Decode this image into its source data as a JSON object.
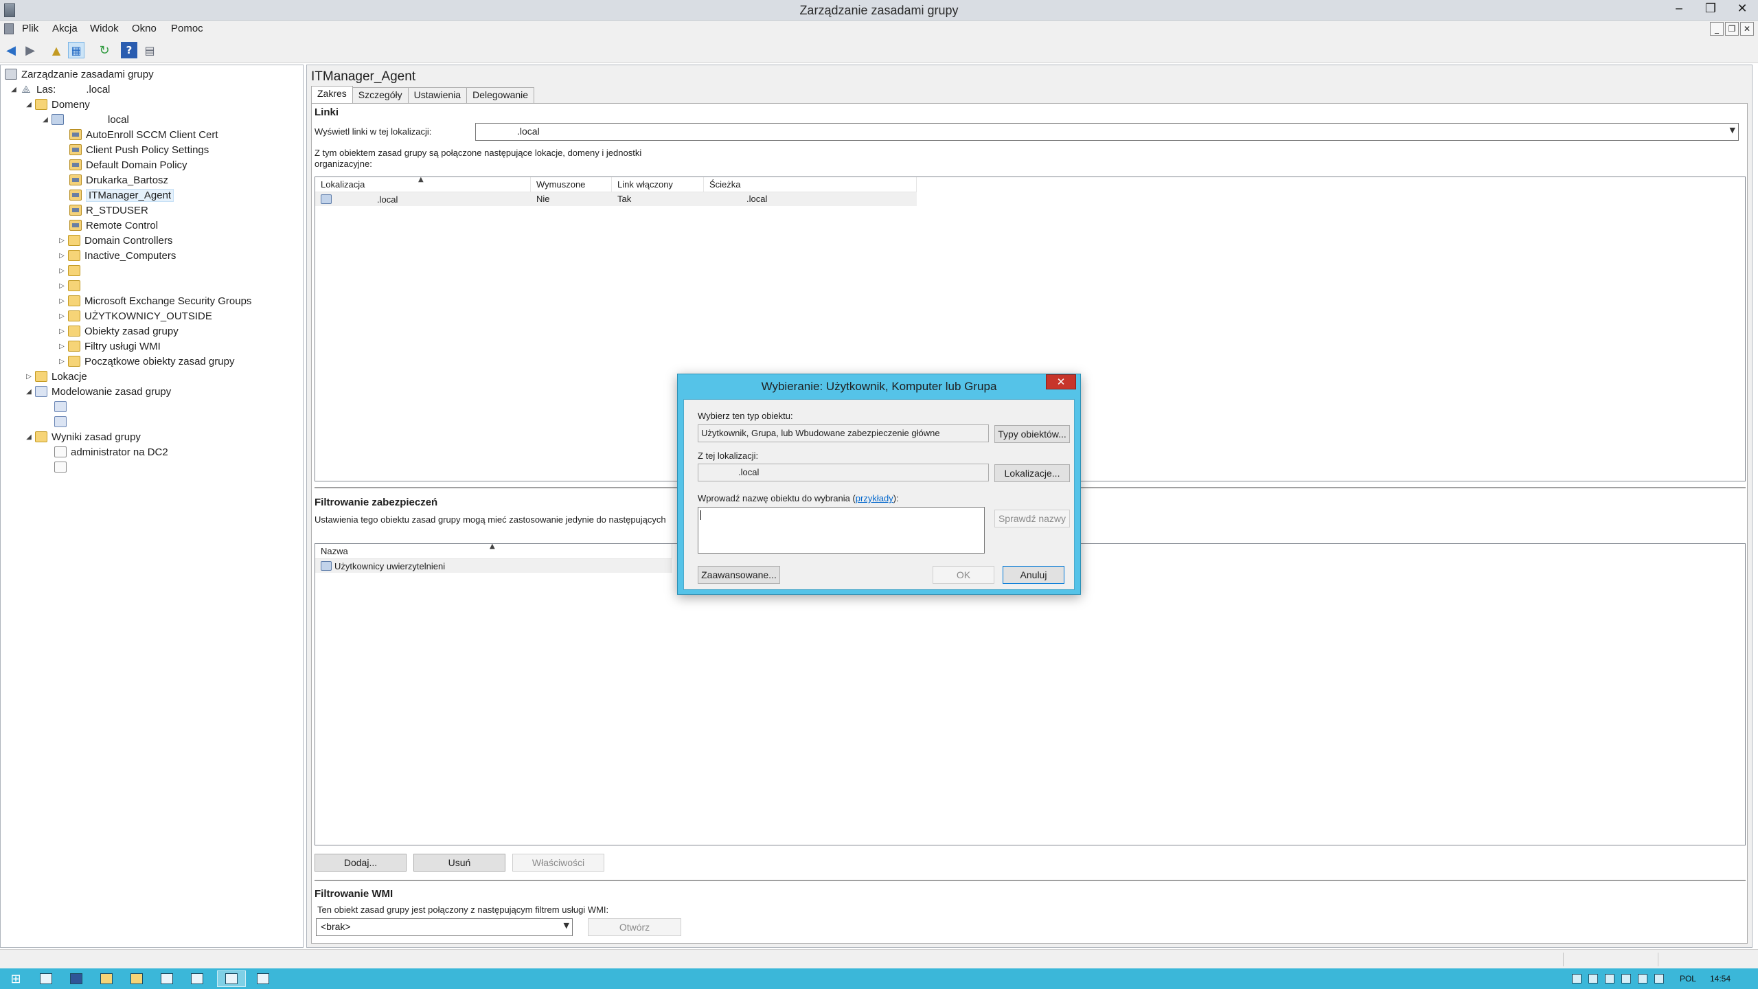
{
  "window": {
    "title": "Zarządzanie zasadami grupy",
    "minimize": "‒",
    "restore": "❐",
    "close": "✕"
  },
  "menu": {
    "items": [
      "Plik",
      "Akcja",
      "Widok",
      "Okno",
      "Pomoc"
    ]
  },
  "mdi": {
    "minimize": "_",
    "restore": "❐",
    "close": "✕"
  },
  "toolbar": {
    "back": "◀",
    "forward": "▶",
    "up": "▲",
    "show_hide": "▦",
    "refresh": "↻",
    "help": "?",
    "view": "▤"
  },
  "tree": {
    "root": "Zarządzanie zasadami grupy",
    "forest_label": "Las:",
    "forest_value": ".local",
    "domains": "Domeny",
    "domain_name": "local",
    "gpos": [
      "AutoEnroll SCCM Client Cert",
      "Client Push Policy Settings",
      "Default Domain Policy",
      "Drukarka_Bartosz",
      "ITManager_Agent",
      "R_STDUSER",
      "Remote Control"
    ],
    "ous": [
      "Domain Controllers",
      "Inactive_Computers",
      "",
      "",
      "Microsoft Exchange Security Groups",
      "UŻYTKOWNICY_OUTSIDE",
      "Obiekty zasad grupy",
      "Filtry usługi WMI",
      "Początkowe obiekty zasad grupy"
    ],
    "sites": "Lokacje",
    "modeling": "Modelowanie zasad grupy",
    "results": "Wyniki zasad grupy",
    "results_item": "administrator na DC2"
  },
  "detail": {
    "title": "ITManager_Agent",
    "tabs": [
      "Zakres",
      "Szczegóły",
      "Ustawienia",
      "Delegowanie"
    ],
    "links": {
      "section": "Linki",
      "show_label": "Wyświetl linki w tej lokalizacji:",
      "location_value": ".local",
      "description": "Z tym obiektem zasad grupy są połączone następujące lokacje, domeny i jednostki organizacyjne:",
      "columns": [
        "Lokalizacja",
        "Wymuszone",
        "Link włączony",
        "Ścieżka"
      ],
      "rows": [
        {
          "location": ".local",
          "enforced": "Nie",
          "enabled": "Tak",
          "path": ".local"
        }
      ]
    },
    "security": {
      "section": "Filtrowanie zabezpieczeń",
      "description": "Ustawienia tego obiektu zasad grupy mogą mieć zastosowanie jedynie do następujących",
      "column": "Nazwa",
      "rows": [
        "Użytkownicy uwierzytelnieni"
      ],
      "add": "Dodaj...",
      "remove": "Usuń",
      "properties": "Właściwości"
    },
    "wmi": {
      "section": "Filtrowanie WMI",
      "description": "Ten obiekt zasad grupy jest połączony z następującym filtrem usługi WMI:",
      "filter_value": "<brak>",
      "open": "Otwórz"
    }
  },
  "dialog": {
    "title": "Wybieranie: Użytkownik, Komputer lub Grupa",
    "close": "✕",
    "object_type_label": "Wybierz ten typ obiektu:",
    "object_type_value": "Użytkownik, Grupa, lub Wbudowane zabezpieczenie główne",
    "object_types_button": "Typy obiektów...",
    "location_label": "Z tej lokalizacji:",
    "location_value": ".local",
    "locations_button": "Lokalizacje...",
    "enter_label": "Wprowadź nazwę obiektu do wybrania (",
    "examples_link": "przykłady",
    "enter_label_end": "):",
    "check_names": "Sprawdź nazwy",
    "advanced": "Zaawansowane...",
    "ok": "OK",
    "cancel": "Anuluj"
  },
  "tray": {
    "language": "POL",
    "time": "14:54"
  },
  "colors": {
    "taskbar": "#3bb7d9",
    "dialog_frame": "#55c3e8",
    "close_red": "#c7352b",
    "link": "#0066cc"
  }
}
